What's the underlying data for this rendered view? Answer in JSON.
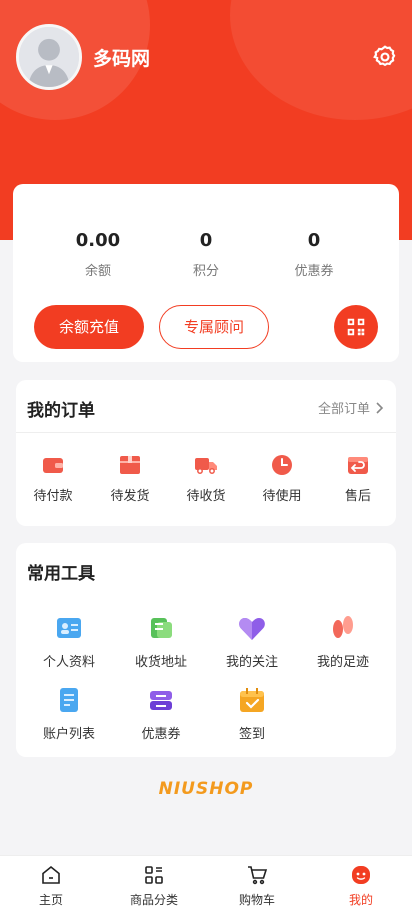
{
  "profile": {
    "username": "多码网"
  },
  "stats": [
    {
      "value": "0.00",
      "label": "余额"
    },
    {
      "value": "0",
      "label": "积分"
    },
    {
      "value": "0",
      "label": "优惠券"
    }
  ],
  "actions": {
    "recharge": "余额充值",
    "advisor": "专属顾问"
  },
  "orders": {
    "title": "我的订单",
    "all_label": "全部订单",
    "items": [
      {
        "label": "待付款",
        "icon": "wallet-icon"
      },
      {
        "label": "待发货",
        "icon": "package-icon"
      },
      {
        "label": "待收货",
        "icon": "truck-icon"
      },
      {
        "label": "待使用",
        "icon": "clock-icon"
      },
      {
        "label": "售后",
        "icon": "return-icon"
      }
    ]
  },
  "tools": {
    "title": "常用工具",
    "items": [
      {
        "label": "个人资料",
        "icon": "profile-card-icon"
      },
      {
        "label": "收货地址",
        "icon": "address-icon"
      },
      {
        "label": "我的关注",
        "icon": "heart-icon"
      },
      {
        "label": "我的足迹",
        "icon": "footprint-icon"
      },
      {
        "label": "账户列表",
        "icon": "account-list-icon"
      },
      {
        "label": "优惠券",
        "icon": "coupon-icon"
      },
      {
        "label": "签到",
        "icon": "sign-in-icon"
      }
    ]
  },
  "brand": "NIUSHOP",
  "tabbar": [
    {
      "label": "主页",
      "icon": "home-icon",
      "active": false
    },
    {
      "label": "商品分类",
      "icon": "category-icon",
      "active": false
    },
    {
      "label": "购物车",
      "icon": "cart-icon",
      "active": false
    },
    {
      "label": "我的",
      "icon": "my-icon",
      "active": true
    }
  ],
  "colors": {
    "primary": "#f23d22",
    "brand": "#f39a1e",
    "background": "#f4f4f6"
  }
}
